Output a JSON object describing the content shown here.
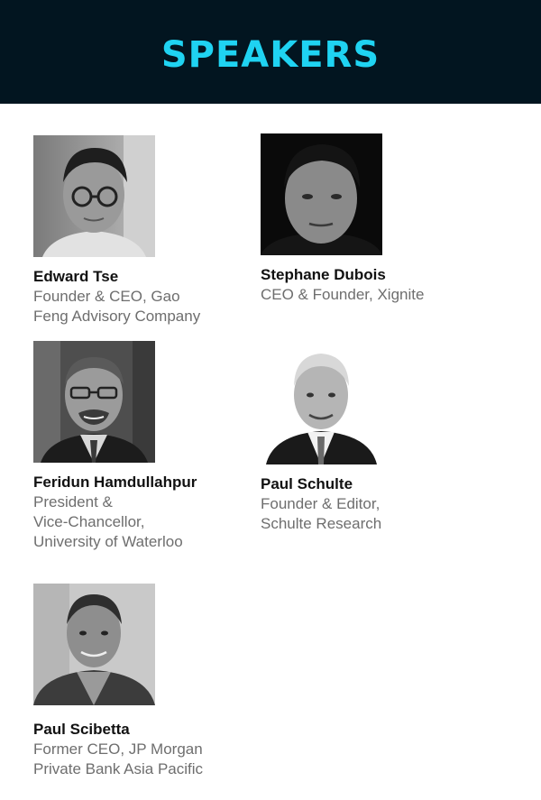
{
  "header": {
    "title": "SPEAKERS",
    "background": "#021520",
    "title_color": "#1fd3f2"
  },
  "speakers": [
    {
      "name": "Edward Tse",
      "role_lines": [
        "Founder & CEO, Gao",
        "Feng Advisory Company"
      ],
      "photo": "speaker-photo-edward-tse"
    },
    {
      "name": "Stephane Dubois",
      "role_lines": [
        "CEO & Founder, Xignite"
      ],
      "photo": "speaker-photo-stephane-dubois"
    },
    {
      "name": "Feridun Hamdullahpur",
      "role_lines": [
        "President &",
        "Vice-Chancellor,",
        "University of Waterloo"
      ],
      "photo": "speaker-photo-feridun-hamdullahpur"
    },
    {
      "name": "Paul Schulte",
      "role_lines": [
        "Founder & Editor,",
        "Schulte Research"
      ],
      "photo": "speaker-photo-paul-schulte"
    },
    {
      "name": "Paul Scibetta",
      "role_lines": [
        "Former CEO, JP Morgan",
        "Private Bank Asia Pacific"
      ],
      "photo": "speaker-photo-paul-scibetta"
    }
  ]
}
